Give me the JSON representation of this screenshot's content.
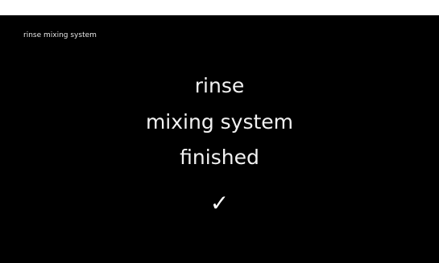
{
  "header": {
    "title": "rinse mixing system"
  },
  "message": {
    "lines": [
      "rinse",
      "mixing system",
      "finished"
    ]
  },
  "status": {
    "icon": "checkmark-icon",
    "glyph": "✓"
  },
  "colors": {
    "background": "#000000",
    "text": "#ffffff"
  }
}
